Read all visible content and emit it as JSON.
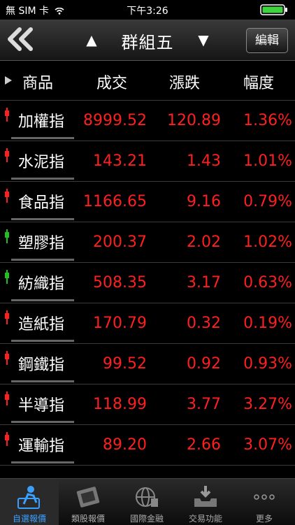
{
  "status": {
    "carrier": "無 SIM 卡",
    "time": "下午3:26"
  },
  "nav": {
    "title": "群組五",
    "prev_label": "▲",
    "next_label": "▼",
    "edit_label": "編輯"
  },
  "columns": {
    "name": "商品",
    "price": "成交",
    "change": "漲跌",
    "pct": "幅度"
  },
  "rows": [
    {
      "name": "加權指",
      "price": "8999.52",
      "change": "120.89",
      "pct": "1.36%",
      "marker": "up"
    },
    {
      "name": "水泥指",
      "price": "143.21",
      "change": "1.43",
      "pct": "1.01%",
      "marker": "up"
    },
    {
      "name": "食品指",
      "price": "1166.65",
      "change": "9.16",
      "pct": "0.79%",
      "marker": "up"
    },
    {
      "name": "塑膠指",
      "price": "200.37",
      "change": "2.02",
      "pct": "1.02%",
      "marker": "up-green"
    },
    {
      "name": "紡織指",
      "price": "508.35",
      "change": "3.17",
      "pct": "0.63%",
      "marker": "up-green"
    },
    {
      "name": "造紙指",
      "price": "170.79",
      "change": "0.32",
      "pct": "0.19%",
      "marker": "up"
    },
    {
      "name": "鋼鐵指",
      "price": "99.52",
      "change": "0.92",
      "pct": "0.93%",
      "marker": "up"
    },
    {
      "name": "半導指",
      "price": "118.99",
      "change": "3.77",
      "pct": "3.27%",
      "marker": "up"
    },
    {
      "name": "運輸指",
      "price": "89.20",
      "change": "2.66",
      "pct": "3.07%",
      "marker": "up"
    }
  ],
  "tabs": [
    {
      "label": "自選報價",
      "active": true
    },
    {
      "label": "類股報價",
      "active": false
    },
    {
      "label": "國際金融",
      "active": false
    },
    {
      "label": "交易功能",
      "active": false
    },
    {
      "label": "更多",
      "active": false
    }
  ],
  "colors": {
    "up": "#ff1f1f",
    "green": "#21c021",
    "active_tab": "#3aa0ff"
  }
}
